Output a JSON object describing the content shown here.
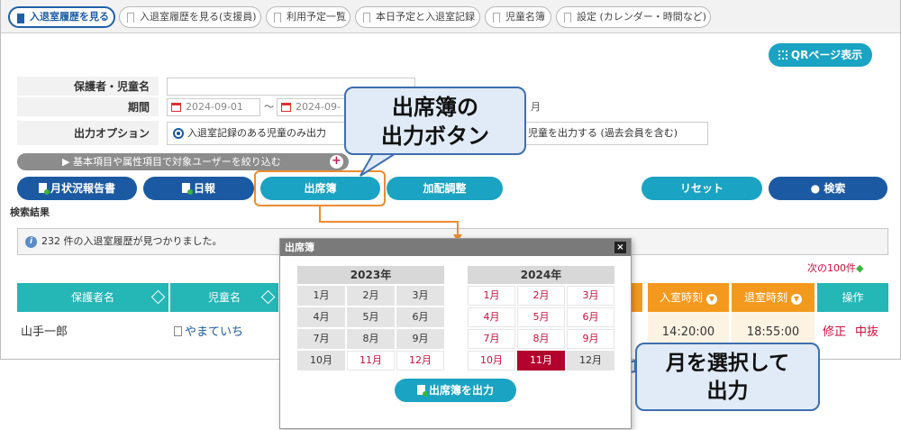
{
  "tabs": [
    {
      "label": "入退室履歴を見る",
      "active": true
    },
    {
      "label": "入退室履歴を見る(支援員)"
    },
    {
      "label": "利用予定一覧"
    },
    {
      "label": "本日予定と入退室記録"
    },
    {
      "label": "児童名簿"
    },
    {
      "label": "設定 (カレンダー・時間など)"
    }
  ],
  "qr_button": "QRページ表示",
  "form": {
    "guardian_label": "保護者・児童名",
    "period_label": "期間",
    "period_from": "2024-09-01",
    "period_sep": "〜",
    "period_to": "2024-09-",
    "period_tail": "月",
    "option_label": "出力オプション",
    "option_1": "入退室記録のある児童のみ出力",
    "option_2": "児童を出力する (過去会員を含む)"
  },
  "filter_bar": "▶ 基本項目や属性項目で対象ユーザーを絞り込む",
  "buttons": {
    "monthly": "月状況報告書",
    "daily": "日報",
    "attendance": "出席簿",
    "adjust": "加配調整",
    "reset": "リセット",
    "search": "● 検索"
  },
  "results": {
    "heading": "検索結果",
    "message": "232 件の入退室履歴が見つかりました。",
    "next": "次の100件"
  },
  "table": {
    "headers": [
      "保護者名",
      "児童名",
      "入室時刻",
      "退室時刻",
      "操作"
    ],
    "row": {
      "guardian": "山手一郎",
      "child": "やまていち",
      "in_time": "14:20:00",
      "out_time": "18:55:00",
      "edit": "修正",
      "cancel": "中抜"
    }
  },
  "modal": {
    "title": "出席簿",
    "close": "×",
    "years": [
      {
        "label": "2023年",
        "months": [
          {
            "m": "1月",
            "state": "none"
          },
          {
            "m": "2月",
            "state": "none"
          },
          {
            "m": "3月",
            "state": "none"
          },
          {
            "m": "4月",
            "state": "none"
          },
          {
            "m": "5月",
            "state": "none"
          },
          {
            "m": "6月",
            "state": "none"
          },
          {
            "m": "7月",
            "state": "none"
          },
          {
            "m": "8月",
            "state": "none"
          },
          {
            "m": "9月",
            "state": "none"
          },
          {
            "m": "10月",
            "state": "none"
          },
          {
            "m": "11月",
            "state": "avail"
          },
          {
            "m": "12月",
            "state": "avail"
          }
        ]
      },
      {
        "label": "2024年",
        "months": [
          {
            "m": "1月",
            "state": "avail"
          },
          {
            "m": "2月",
            "state": "avail"
          },
          {
            "m": "3月",
            "state": "avail"
          },
          {
            "m": "4月",
            "state": "avail"
          },
          {
            "m": "5月",
            "state": "avail"
          },
          {
            "m": "6月",
            "state": "avail"
          },
          {
            "m": "7月",
            "state": "avail"
          },
          {
            "m": "8月",
            "state": "avail"
          },
          {
            "m": "9月",
            "state": "avail"
          },
          {
            "m": "10月",
            "state": "avail"
          },
          {
            "m": "11月",
            "state": "selected"
          },
          {
            "m": "12月",
            "state": "none"
          }
        ]
      }
    ],
    "output_button": "出席簿を出力"
  },
  "callouts": {
    "attendance_line1": "出席簿の",
    "attendance_line2": "出力ボタン",
    "select_line1": "月を選択して",
    "select_line2": "出力"
  },
  "colors": {
    "teal": "#1aa3c2",
    "navy": "#1b5aa3",
    "table_teal": "#25b6b6",
    "table_orange": "#f39a1e",
    "selected_month": "#b3002d",
    "callout_fill": "#e0ebf7",
    "highlight": "#ec8c30"
  }
}
